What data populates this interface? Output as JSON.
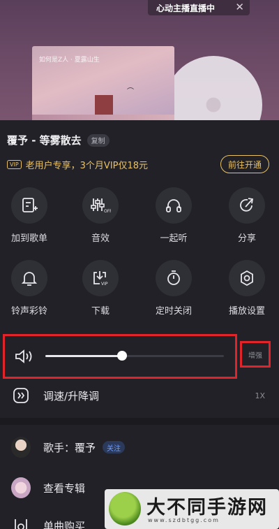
{
  "live_banner": {
    "label": "心动主播直播中",
    "close_icon": "close-icon"
  },
  "album": {
    "cover_text": "如何是Z人 · 夏露山生"
  },
  "song": {
    "title": "覆予 - 等雾散去",
    "copy_label": "复制"
  },
  "vip": {
    "badge": "VIP",
    "promo": "老用户专享，3个月VIP仅18元",
    "button": "前往开通"
  },
  "actions": [
    {
      "label": "加到歌单",
      "icon": "add-playlist-icon"
    },
    {
      "label": "音效",
      "icon": "sound-effect-icon"
    },
    {
      "label": "一起听",
      "icon": "headphones-icon"
    },
    {
      "label": "分享",
      "icon": "share-icon"
    },
    {
      "label": "铃声彩铃",
      "icon": "bell-icon"
    },
    {
      "label": "下载",
      "icon": "download-vip-icon"
    },
    {
      "label": "定时关闭",
      "icon": "timer-icon"
    },
    {
      "label": "播放设置",
      "icon": "settings-icon"
    }
  ],
  "volume": {
    "level": 0.43,
    "boost_label": "增强"
  },
  "speed": {
    "label": "调速/升降调",
    "value": "1X"
  },
  "artist": {
    "label": "歌手：覆予",
    "follow": "关注"
  },
  "album_row": {
    "label": "查看专辑"
  },
  "single_purchase": {
    "label": "单曲购买"
  },
  "watermark": {
    "title": "大不同手游网",
    "url": "www.szdbtgg.com"
  }
}
